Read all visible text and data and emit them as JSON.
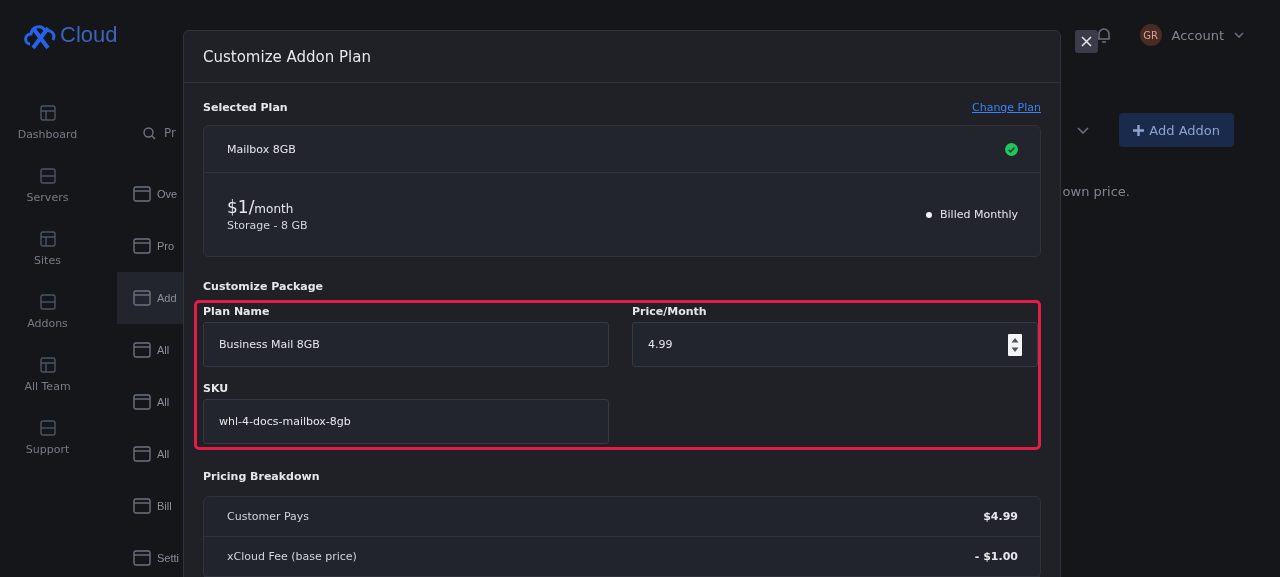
{
  "app": {
    "logo": "Cloud",
    "avatar": "GR",
    "account": "Account"
  },
  "sidebar": {
    "items": [
      {
        "label": "Dashboard"
      },
      {
        "label": "Servers"
      },
      {
        "label": "Sites"
      },
      {
        "label": "Addons"
      },
      {
        "label": "All Team"
      },
      {
        "label": "Support"
      }
    ]
  },
  "subnav": {
    "search_placeholder": "Pr",
    "items": [
      {
        "label": "Ove",
        "selected": false
      },
      {
        "label": "Pro",
        "selected": false
      },
      {
        "label": "Add",
        "selected": true
      },
      {
        "label": "All",
        "selected": false
      },
      {
        "label": "All",
        "selected": false
      },
      {
        "label": "All",
        "selected": false
      },
      {
        "label": "Bill",
        "selected": false
      },
      {
        "label": "Setti",
        "selected": false
      }
    ]
  },
  "page": {
    "add_button": "Add Addon",
    "description": "own price."
  },
  "modal": {
    "title": "Customize Addon Plan",
    "selected_plan": {
      "heading": "Selected Plan",
      "change_link": "Change Plan",
      "name": "Mailbox 8GB",
      "selected": true,
      "price": "$1/",
      "period": "month",
      "detail": "Storage - 8 GB",
      "billing": "Billed Monthly"
    },
    "customize": {
      "heading": "Customize Package",
      "highlighted": true,
      "fields": [
        {
          "label": "Plan Name",
          "value": "Business Mail 8GB",
          "kind": "text"
        },
        {
          "label": "Price/Month",
          "value": "4.99",
          "kind": "number"
        },
        {
          "label": "SKU",
          "value": "whl-4-docs-mailbox-8gb",
          "kind": "text"
        }
      ]
    },
    "pricing": {
      "heading": "Pricing Breakdown",
      "rows": [
        {
          "label": "Customer Pays",
          "value": "$4.99"
        },
        {
          "label": "xCloud Fee (base price)",
          "value": "- $1.00"
        }
      ]
    }
  }
}
